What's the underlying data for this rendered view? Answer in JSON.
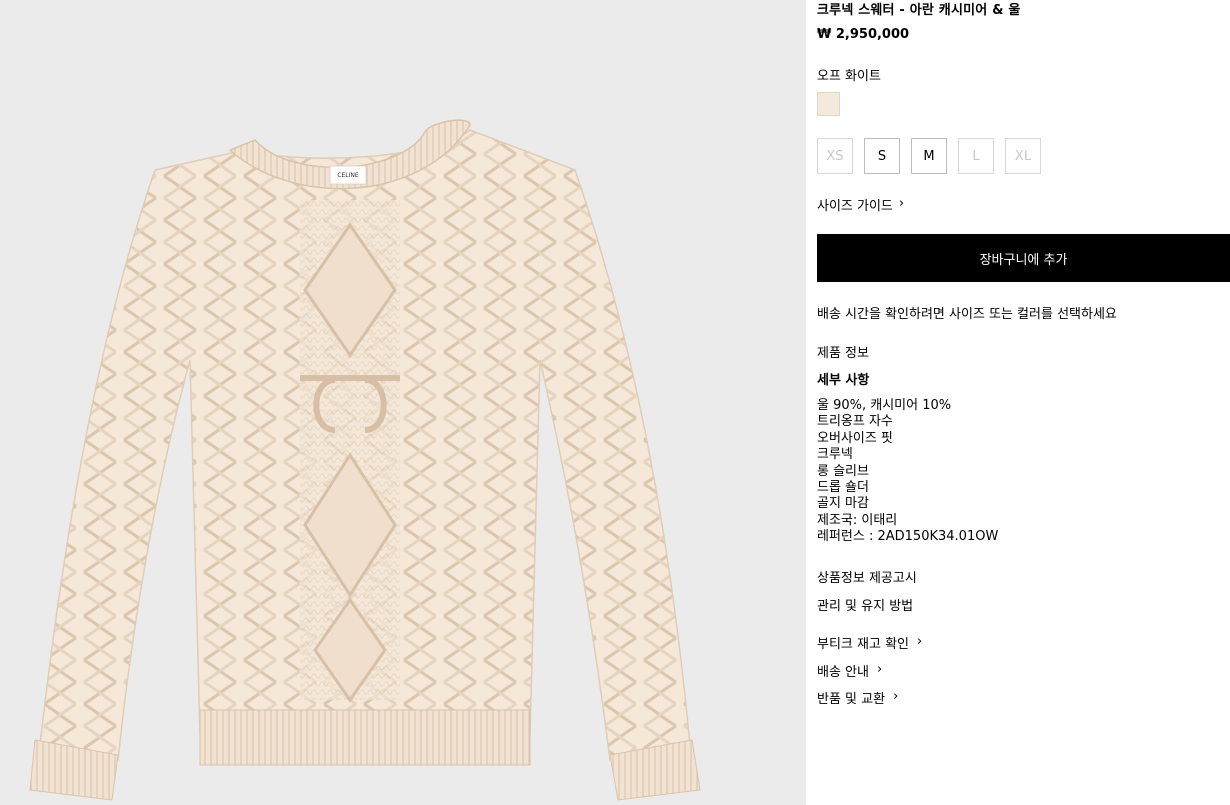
{
  "product": {
    "title": "크루넥 스웨터 - 아란 캐시미어 & 울",
    "price": "₩ 2,950,000",
    "color_name": "오프 화이트",
    "label_text": "CELINE"
  },
  "swatch_color": "#f3eadc",
  "sizes": [
    {
      "label": "XS",
      "available": false
    },
    {
      "label": "S",
      "available": true
    },
    {
      "label": "M",
      "available": true
    },
    {
      "label": "L",
      "available": false
    },
    {
      "label": "XL",
      "available": false
    }
  ],
  "size_guide_label": "사이즈 가이드",
  "add_to_cart_label": "장바구니에 추가",
  "shipping_note": "배송 시간을 확인하려면 사이즈 또는 컬러를 선택하세요",
  "product_info_label": "제품 정보",
  "details": {
    "heading": "세부 사항",
    "items": [
      "울 90%, 캐시미어 10%",
      "트리옹프 자수",
      "오버사이즈 핏",
      "크루넥",
      "롱 슬리브",
      "드롭 숄더",
      "골지 마감",
      "제조국: 이태리",
      "레퍼런스 : 2AD150K34.01OW"
    ]
  },
  "notice_label": "상품정보 제공고시",
  "care_label": "관리 및 유지 방법",
  "links": {
    "boutique_stock": "부티크 재고 확인",
    "delivery_info": "배송 안내",
    "returns": "반품 및 교환"
  },
  "icons": {
    "chevron": "chevron-right-icon"
  }
}
